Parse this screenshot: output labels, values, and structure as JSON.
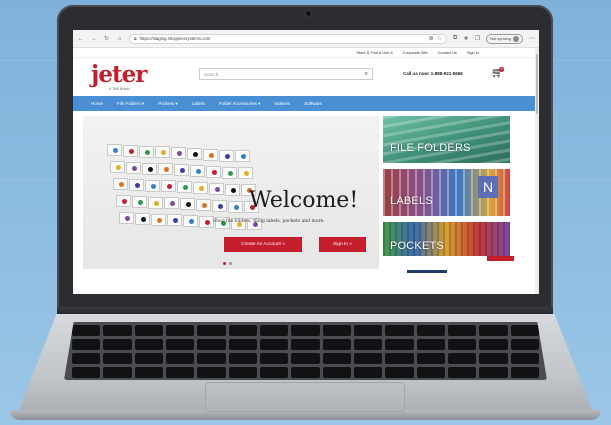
{
  "browser": {
    "url": "https://staging.shopjetersystems.com",
    "profile_label": "Not syncing"
  },
  "site": {
    "top_links": [
      "Store & Find A Use It",
      "Corporate Site",
      "Contact Us",
      "Sign In"
    ],
    "logo_text": "jeter",
    "logo_tagline": "A TAB Brand",
    "search_placeholder": "Search...",
    "call_text": "Call us now: 1-888-921-5666",
    "cart_count": "0",
    "menu": [
      {
        "label": "Home"
      },
      {
        "label": "File Folders",
        "caret": "▾"
      },
      {
        "label": "Pockets",
        "caret": "▾"
      },
      {
        "label": "Labels"
      },
      {
        "label": "Folder Accessories",
        "caret": "▾"
      },
      {
        "label": "Indexes"
      },
      {
        "label": "Software"
      }
    ],
    "hero": {
      "heading": "Welcome!",
      "subtext": "Shop file folders, filing labels, pockets and more.",
      "create_account": "Create An Account »",
      "sign_in": "Sign In »"
    },
    "tiles": [
      {
        "label": "FILE FOLDERS",
        "color": "#3f8f78"
      },
      {
        "label": "LABELS",
        "color": "#8a4f8a"
      },
      {
        "label": "POCKETS",
        "color": "#3d6bb0"
      }
    ],
    "tile_n_letter": "N"
  },
  "colors": {
    "brand_red": "#c41d2b",
    "menu_blue": "#4a8fd4"
  }
}
